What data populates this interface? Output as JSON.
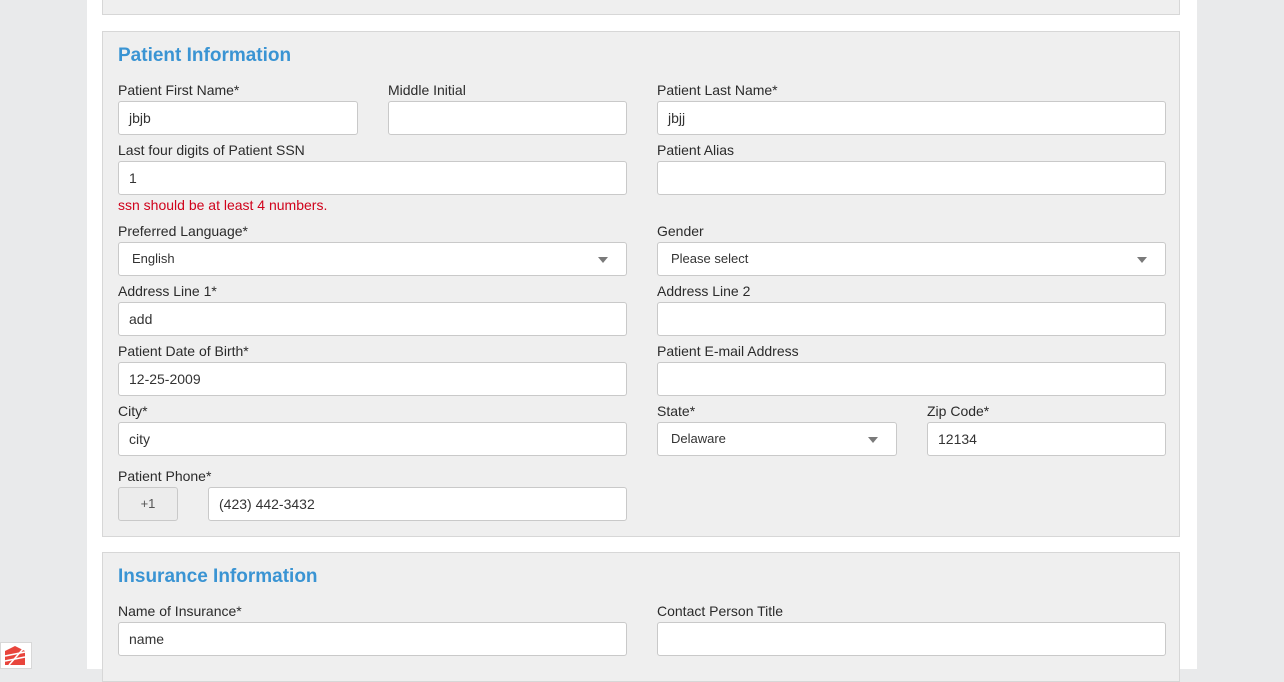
{
  "patient": {
    "title": "Patient Information",
    "first_name": {
      "label": "Patient First Name*",
      "value": "jbjb"
    },
    "middle_initial": {
      "label": "Middle Initial",
      "value": ""
    },
    "last_name": {
      "label": "Patient Last Name*",
      "value": "jbjj"
    },
    "ssn": {
      "label": "Last four digits of Patient SSN",
      "value": "1",
      "error": "ssn should be at least 4 numbers."
    },
    "alias": {
      "label": "Patient Alias",
      "value": ""
    },
    "language": {
      "label": "Preferred Language*",
      "value": "English"
    },
    "gender": {
      "label": "Gender",
      "value": "Please select"
    },
    "address1": {
      "label": "Address Line 1*",
      "value": "add"
    },
    "address2": {
      "label": "Address Line 2",
      "value": ""
    },
    "dob": {
      "label": "Patient Date of Birth*",
      "value": "12-25-2009"
    },
    "email": {
      "label": "Patient E-mail Address",
      "value": ""
    },
    "city": {
      "label": "City*",
      "value": "city"
    },
    "state": {
      "label": "State*",
      "value": "Delaware"
    },
    "zip": {
      "label": "Zip Code*",
      "value": "12134"
    },
    "phone": {
      "label": "Patient Phone*",
      "prefix": "+1",
      "value": "(423) 442-3432"
    }
  },
  "insurance": {
    "title": "Insurance Information",
    "name": {
      "label": "Name of Insurance*",
      "value": "name"
    },
    "contact_title": {
      "label": "Contact Person Title",
      "value": ""
    }
  },
  "colors": {
    "accent": "#3a94d3",
    "error": "#d0021b"
  },
  "icons": {
    "corner": "app-logo-icon"
  }
}
